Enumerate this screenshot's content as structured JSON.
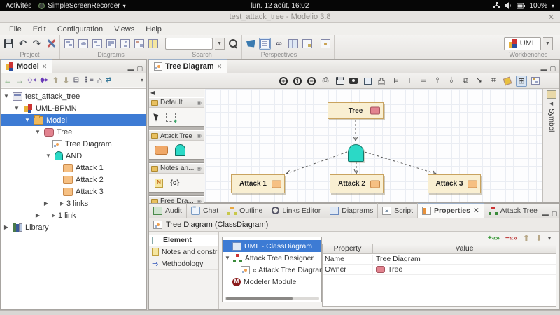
{
  "topbar": {
    "activities": "Activités",
    "app_name": "SimpleScreenRecorder",
    "clock": "lun. 12 août, 16:02",
    "battery_pct": "100%"
  },
  "window": {
    "title": "test_attack_tree - Modelio 3.8",
    "close": "✕"
  },
  "menubar": {
    "items": [
      "File",
      "Edit",
      "Configuration",
      "Views",
      "Help"
    ]
  },
  "toolbar": {
    "project_label": "Project",
    "diagrams_label": "Diagrams",
    "search_label": "Search",
    "perspectives_label": "Perspectives",
    "workbenches_label": "Workbenches",
    "workbench_value": "UML"
  },
  "explorer": {
    "tab_label": "Model",
    "items": [
      {
        "label": "test_attack_tree"
      },
      {
        "label": "UML-BPMN"
      },
      {
        "label": "Model"
      },
      {
        "label": "Tree"
      },
      {
        "label": "Tree Diagram"
      },
      {
        "label": "AND"
      },
      {
        "label": "Attack 1"
      },
      {
        "label": "Attack 2"
      },
      {
        "label": "Attack 3"
      },
      {
        "label": "3 links"
      },
      {
        "label": "1 link"
      },
      {
        "label": "Library"
      }
    ]
  },
  "editor": {
    "tab_label": "Tree Diagram",
    "symbol_tab": "Symbol",
    "palette": {
      "sections": [
        {
          "label": "Default"
        },
        {
          "label": "Attack Tree"
        },
        {
          "label": "Notes an..."
        },
        {
          "label": "Free Dra..."
        }
      ]
    },
    "nodes": {
      "root": "Tree",
      "gate": "AND",
      "child1": "Attack 1",
      "child2": "Attack 2",
      "child3": "Attack 3"
    }
  },
  "bottom": {
    "tabs": [
      {
        "label": "Audit"
      },
      {
        "label": "Chat"
      },
      {
        "label": "Outline"
      },
      {
        "label": "Links Editor"
      },
      {
        "label": "Diagrams"
      },
      {
        "label": "Script"
      },
      {
        "label": "Properties"
      },
      {
        "label": "Attack Tree"
      }
    ],
    "header": "Tree Diagram (ClassDiagram)",
    "side_tabs": [
      {
        "label": "Element"
      },
      {
        "label": "Notes and constraints"
      },
      {
        "label": "Methodology"
      }
    ],
    "module_tree": [
      {
        "label": "UML - ClassDiagram"
      },
      {
        "label": "Attack Tree Designer"
      },
      {
        "label": "« Attack Tree Diagram »"
      },
      {
        "label": "Modeler Module"
      }
    ],
    "table": {
      "col_property": "Property",
      "col_value": "Value",
      "rows": [
        {
          "property": "Name",
          "value": "Tree Diagram"
        },
        {
          "property": "Owner",
          "value": "Tree"
        }
      ]
    }
  },
  "colors": {
    "selection": "#3d7bd4",
    "node_fill": "#f9efd2",
    "node_border": "#c9a35f",
    "and_fill": "#2bd9c6",
    "badge_pink": "#e2838f",
    "badge_orange": "#f6c083"
  }
}
